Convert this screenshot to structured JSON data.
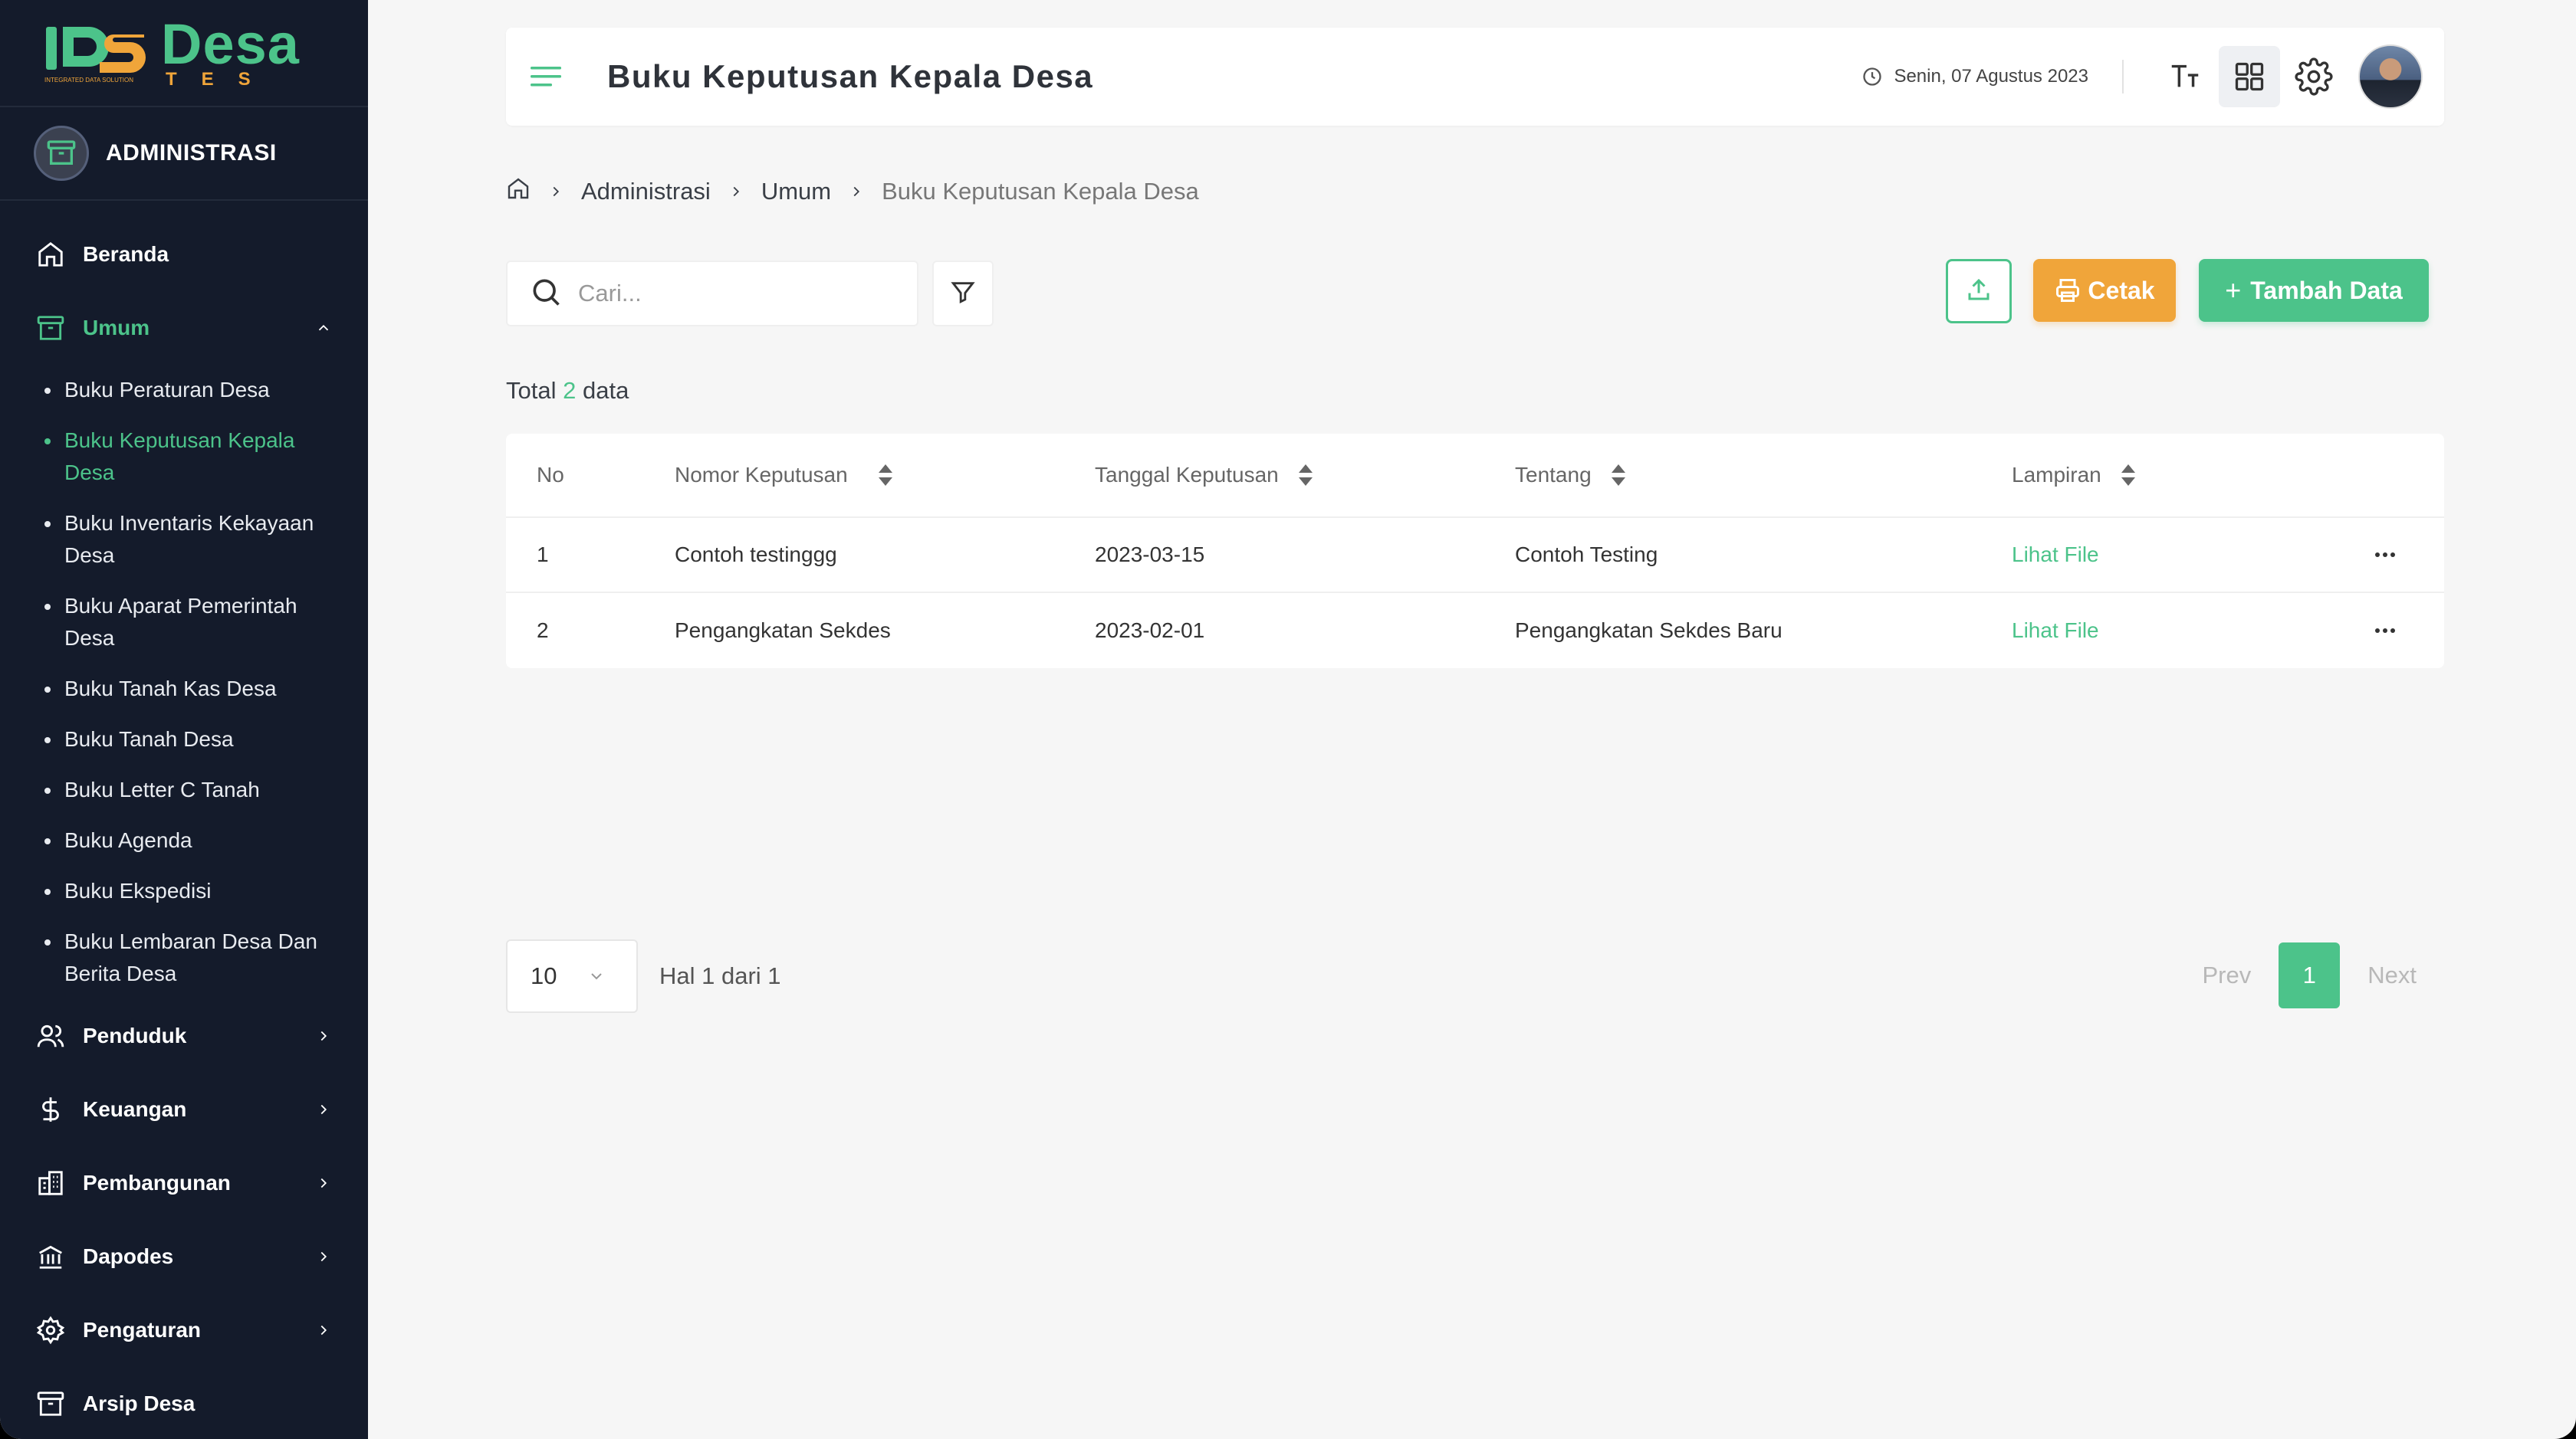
{
  "brand": {
    "title": "Desa",
    "subtitle": "TES",
    "tagline": "INTEGRATED DATA SOLUTION"
  },
  "section": {
    "label": "ADMINISTRASI"
  },
  "sidebar": {
    "items": [
      {
        "label": "Beranda",
        "icon": "home-icon"
      },
      {
        "label": "Umum",
        "icon": "archive-icon",
        "expanded": true
      },
      {
        "label": "Penduduk",
        "icon": "users-icon"
      },
      {
        "label": "Keuangan",
        "icon": "dollar-icon"
      },
      {
        "label": "Pembangunan",
        "icon": "building-icon"
      },
      {
        "label": "Dapodes",
        "icon": "bank-icon"
      },
      {
        "label": "Pengaturan",
        "icon": "gear-icon"
      },
      {
        "label": "Arsip Desa",
        "icon": "archive-icon"
      }
    ],
    "submenu": [
      "Buku Peraturan Desa",
      "Buku Keputusan Kepala Desa",
      "Buku Inventaris Kekayaan Desa",
      "Buku Aparat Pemerintah Desa",
      "Buku Tanah Kas Desa",
      "Buku Tanah Desa",
      "Buku Letter C Tanah",
      "Buku Agenda",
      "Buku Ekspedisi",
      "Buku Lembaran Desa Dan Berita Desa"
    ],
    "active_submenu": "Buku Keputusan Kepala Desa"
  },
  "header": {
    "title": "Buku Keputusan Kepala Desa",
    "date": "Senin, 07 Agustus 2023"
  },
  "breadcrumb": [
    "Administrasi",
    "Umum",
    "Buku Keputusan Kepala Desa"
  ],
  "toolbar": {
    "search_placeholder": "Cari...",
    "print_label": "Cetak",
    "add_label": "Tambah Data"
  },
  "summary": {
    "prefix": "Total",
    "count": "2",
    "suffix": "data"
  },
  "table": {
    "headers": [
      "No",
      "Nomor Keputusan",
      "Tanggal Keputusan",
      "Tentang",
      "Lampiran"
    ],
    "rows": [
      {
        "no": "1",
        "nomor": "Contoh testinggg",
        "tanggal": "2023-03-15",
        "tentang": "Contoh Testing",
        "lampiran": "Lihat File"
      },
      {
        "no": "2",
        "nomor": "Pengangkatan Sekdes",
        "tanggal": "2023-02-01",
        "tentang": "Pengangkatan Sekdes Baru",
        "lampiran": "Lihat File"
      }
    ]
  },
  "pagination": {
    "page_size": "10",
    "info": "Hal 1 dari 1",
    "prev": "Prev",
    "current": "1",
    "next": "Next"
  },
  "colors": {
    "accent": "#4cc38a",
    "warning": "#f0a53a",
    "sidebar": "#141b2b",
    "background": "#f6f6f6"
  }
}
